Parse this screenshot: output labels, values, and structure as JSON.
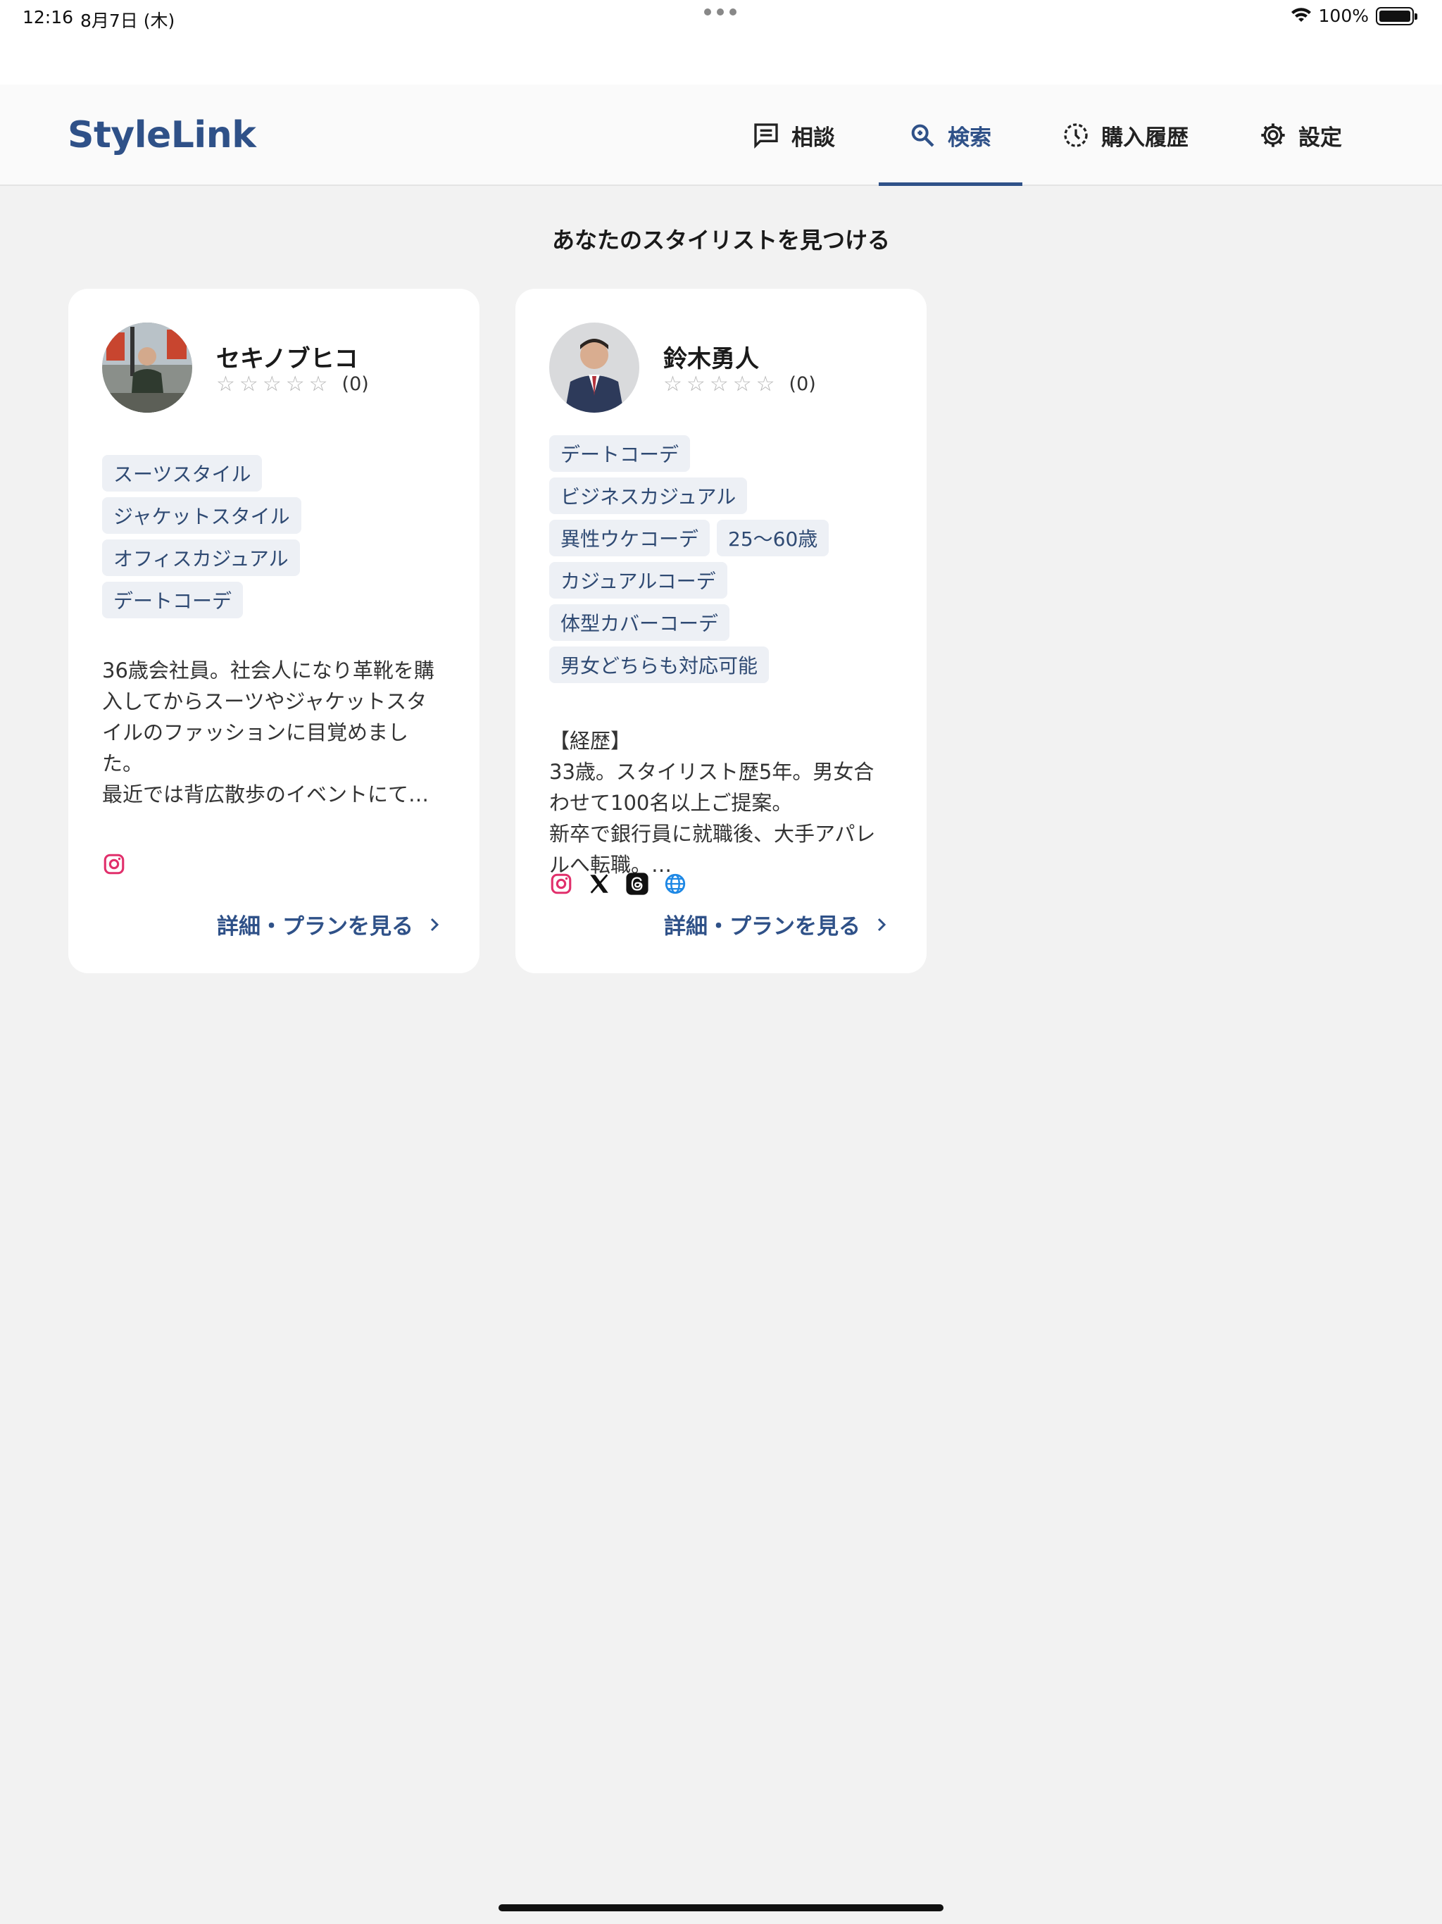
{
  "status_bar": {
    "time": "12:16",
    "date": "8月7日 (木)",
    "battery_percent": "100%"
  },
  "header": {
    "logo": "StyleLink",
    "nav": [
      {
        "label": "相談",
        "icon": "chat-icon",
        "active": false
      },
      {
        "label": "検索",
        "icon": "search-icon",
        "active": true
      },
      {
        "label": "購入履歴",
        "icon": "history-icon",
        "active": false
      },
      {
        "label": "設定",
        "icon": "gear-icon",
        "active": false
      }
    ]
  },
  "main": {
    "heading": "あなたのスタイリストを見つける",
    "stylists": [
      {
        "name": "セキノブヒコ",
        "rating_count": "(0)",
        "rating_stars": 0,
        "tags": [
          "スーツスタイル",
          "ジャケットスタイル",
          "オフィスカジュアル",
          "デートコーデ"
        ],
        "bio": "36歳会社員。社会人になり革靴を購\n入してからスーツやジャケットスタ\nイルのファッションに目覚めまし\nた。\n最近では背広散歩のイベントにて…",
        "socials": [
          "instagram-icon"
        ],
        "cta": "詳細・プランを見る"
      },
      {
        "name": "鈴木勇人",
        "rating_count": "(0)",
        "rating_stars": 0,
        "tags": [
          "デートコーデ",
          "ビジネスカジュアル",
          "異性ウケコーデ",
          "25〜60歳",
          "カジュアルコーデ",
          "体型カバーコーデ",
          "男女どちらも対応可能"
        ],
        "bio": "【経歴】\n33歳。スタイリスト歴5年。男女合\nわせて100名以上ご提案。\n新卒で銀行員に就職後、大手アパレ\nルへ転職。…",
        "socials": [
          "instagram-icon",
          "x-icon",
          "threads-icon",
          "globe-icon"
        ],
        "cta": "詳細・プランを見る"
      }
    ]
  },
  "colors": {
    "accent": "#2f5188",
    "tag_bg": "#edf0f5",
    "page_bg": "#f2f2f2",
    "instagram": "#e1306c",
    "globe": "#1e88e5"
  }
}
